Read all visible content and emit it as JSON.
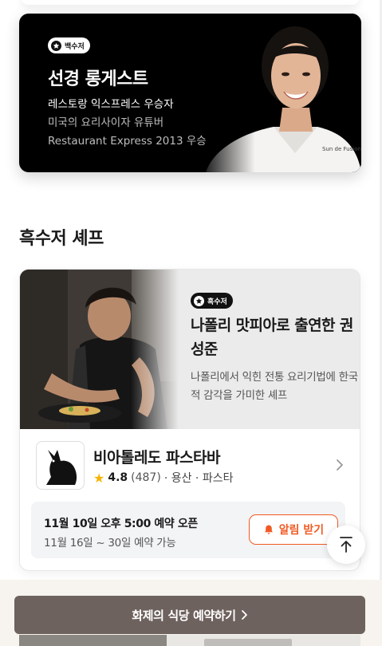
{
  "banner": {
    "badge": "백수저",
    "title": "선경 롱게스트",
    "lines": [
      "레스토랑 익스프레스 우승자",
      "미국의 요리사이자 유튜버",
      "Restaurant Express 2013 우승"
    ],
    "coat_text": "Sun de Fusion"
  },
  "section": {
    "title": "흑수저 셰프"
  },
  "feature": {
    "badge": "흑수저",
    "title": "나폴리 맛피아로 출연한 권성준",
    "description": "나폴리에서 익힌 전통 요리기법에 한국적 감각을 가미한 셰프",
    "restaurant": {
      "name": "비아톨레도 파스타바",
      "rating": "4.8",
      "reviews": "(487)",
      "location": "· 용산 · 파스타"
    },
    "reservation": {
      "open_text": "11월 10일 오후 5:00 예약 오픈",
      "range_text": "11월 16일 ~ 30일 예약 가능",
      "alert_label": "알림 받기"
    }
  },
  "cta": {
    "label": "화제의 식당 예약하기"
  },
  "colors": {
    "accent": "#f15a24",
    "cta": "#6e625e",
    "star": "#f5b400"
  }
}
